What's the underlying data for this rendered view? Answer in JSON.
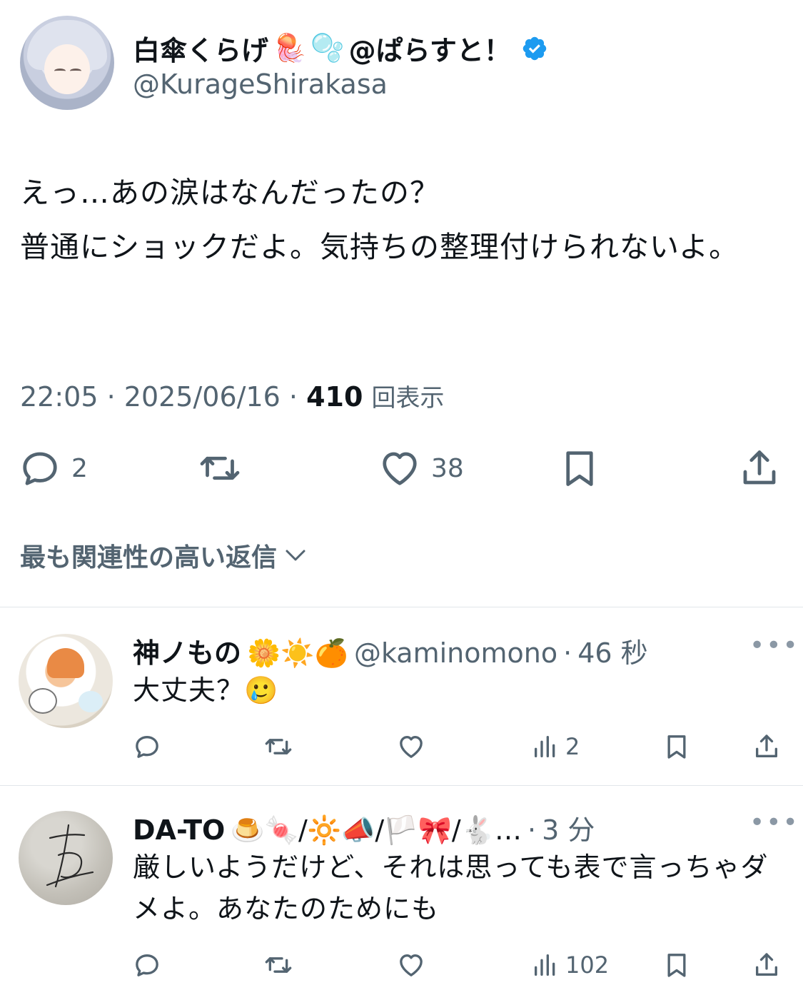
{
  "tweet": {
    "display_name": "白傘くらげ",
    "name_emoji_1": "🪼",
    "name_emoji_2": "🫧",
    "name_suffix": "@ぱらすと！",
    "handle": "@KurageShirakasa",
    "text": "えっ…あの涙はなんだったの？\n普通にショックだよ。気持ちの整理付けられないよ。",
    "time": "22:05",
    "date": "2025/06/16",
    "views": "410",
    "views_label": "回表示",
    "replies": "2",
    "likes": "38"
  },
  "sort": {
    "label": "最も関連性の高い返信"
  },
  "replies": [
    {
      "name": "神ノもの",
      "name_emojis": "🌼☀️🍊",
      "handle": "@kaminomono",
      "time": "46 秒",
      "text": "大丈夫？🥲",
      "views": "2"
    },
    {
      "name": "DA-TO",
      "name_emojis": "🍮🍬/🔆📣/🏳️🎀/🐇…",
      "time": "3 分",
      "text": "厳しいようだけど、それは思っても表で言っちゃダメよ。あなたのためにも",
      "views": "102"
    }
  ],
  "colors": {
    "text": "#0f1419",
    "secondary": "#536471",
    "verified": "#1d9bf0",
    "divider": "#e1e6ea"
  },
  "icons": [
    "reply-icon",
    "retweet-icon",
    "like-icon",
    "bookmark-icon",
    "share-icon",
    "views-icon",
    "more-icon",
    "verified-icon",
    "chevron-down-icon"
  ]
}
